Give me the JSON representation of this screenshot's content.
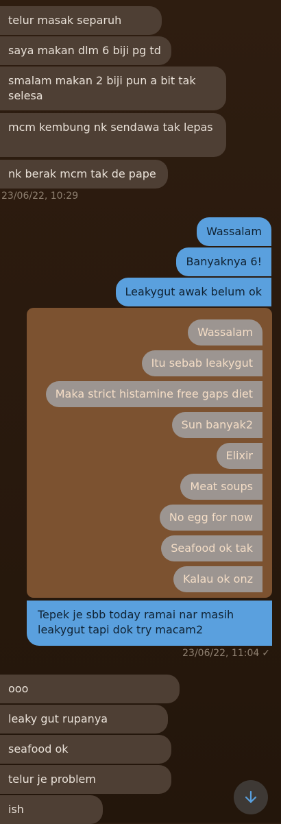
{
  "incoming_group_1": [
    "telur masak separuh",
    "saya makan dlm 6 biji pg td",
    "smalam makan 2 biji pun a bit tak selesa",
    "mcm kembung nk sendawa tak lepas",
    "nk berak mcm tak de pape"
  ],
  "timestamp_1": "23/06/22, 10:29",
  "outgoing": [
    "Wassalam",
    "Banyaknya 6!",
    "Leakygut awak belum ok"
  ],
  "screenshot_bubbles": [
    "Wassalam",
    "Itu sebab leakygut",
    "Maka strict histamine free gaps diet",
    "Sun banyak2",
    "Elixir",
    "Meat soups",
    "No egg for now",
    "Seafood ok tak",
    "Kalau ok onz"
  ],
  "outgoing_caption": "Tepek je sbb today ramai nar masih leakygut tapi dok try macam2",
  "timestamp_2": "23/06/22, 11:04",
  "read_check": "✓",
  "incoming_group_2": [
    "ooo",
    "leaky gut rupanya",
    "seafood ok",
    "telur je problem",
    "ish"
  ],
  "icons": {
    "scroll_down": "arrow-down-icon"
  },
  "colors": {
    "incoming_bg": "#4e3f34",
    "outgoing_bg": "#5aa0de",
    "screenshot_bg": "#7c5230",
    "scroll_arrow": "#5aa0de"
  }
}
